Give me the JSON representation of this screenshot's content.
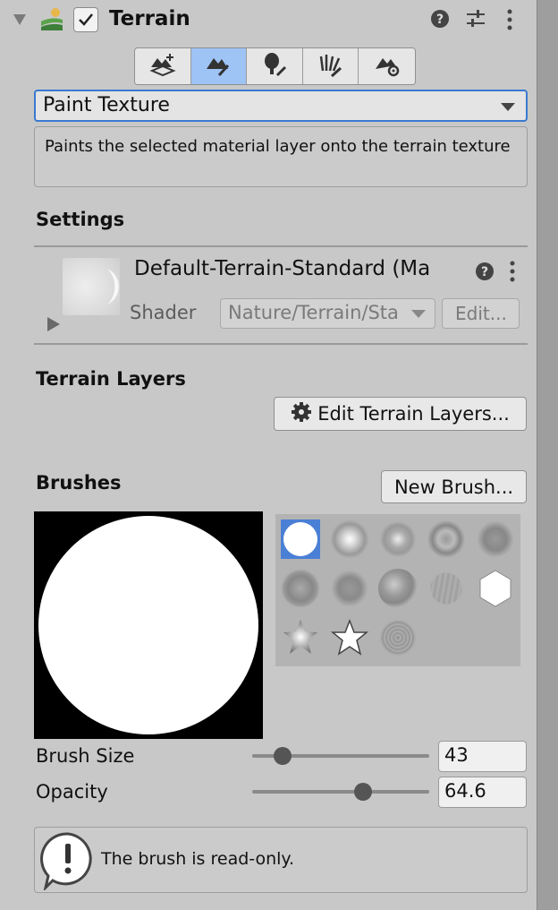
{
  "header": {
    "title": "Terrain",
    "enabled": true
  },
  "toolbar": {
    "tools": [
      {
        "name": "create-neighbor-terrains-icon"
      },
      {
        "name": "paint-terrain-icon",
        "active": true
      },
      {
        "name": "paint-trees-icon"
      },
      {
        "name": "paint-details-icon"
      },
      {
        "name": "terrain-settings-icon"
      }
    ],
    "active_color": "#9ec3f5"
  },
  "mode_dropdown": {
    "value": "Paint Texture"
  },
  "description": "Paints the selected material layer onto the terrain texture",
  "settings": {
    "heading": "Settings",
    "material_name": "Default-Terrain-Standard (Ma",
    "shader_label": "Shader",
    "shader_value": "Nature/Terrain/Sta",
    "edit_label": "Edit..."
  },
  "terrain_layers": {
    "heading": "Terrain Layers",
    "edit_button": "Edit Terrain Layers..."
  },
  "brushes": {
    "heading": "Brushes",
    "new_brush_button": "New Brush...",
    "selected_index": 0,
    "selection_color": "#4a7fd6"
  },
  "brush_size": {
    "label": "Brush Size",
    "value": "43",
    "slider_fraction": 0.18
  },
  "opacity": {
    "label": "Opacity",
    "value": "64.6",
    "slider_fraction": 0.65
  },
  "help": {
    "message": "The brush is read-only."
  }
}
